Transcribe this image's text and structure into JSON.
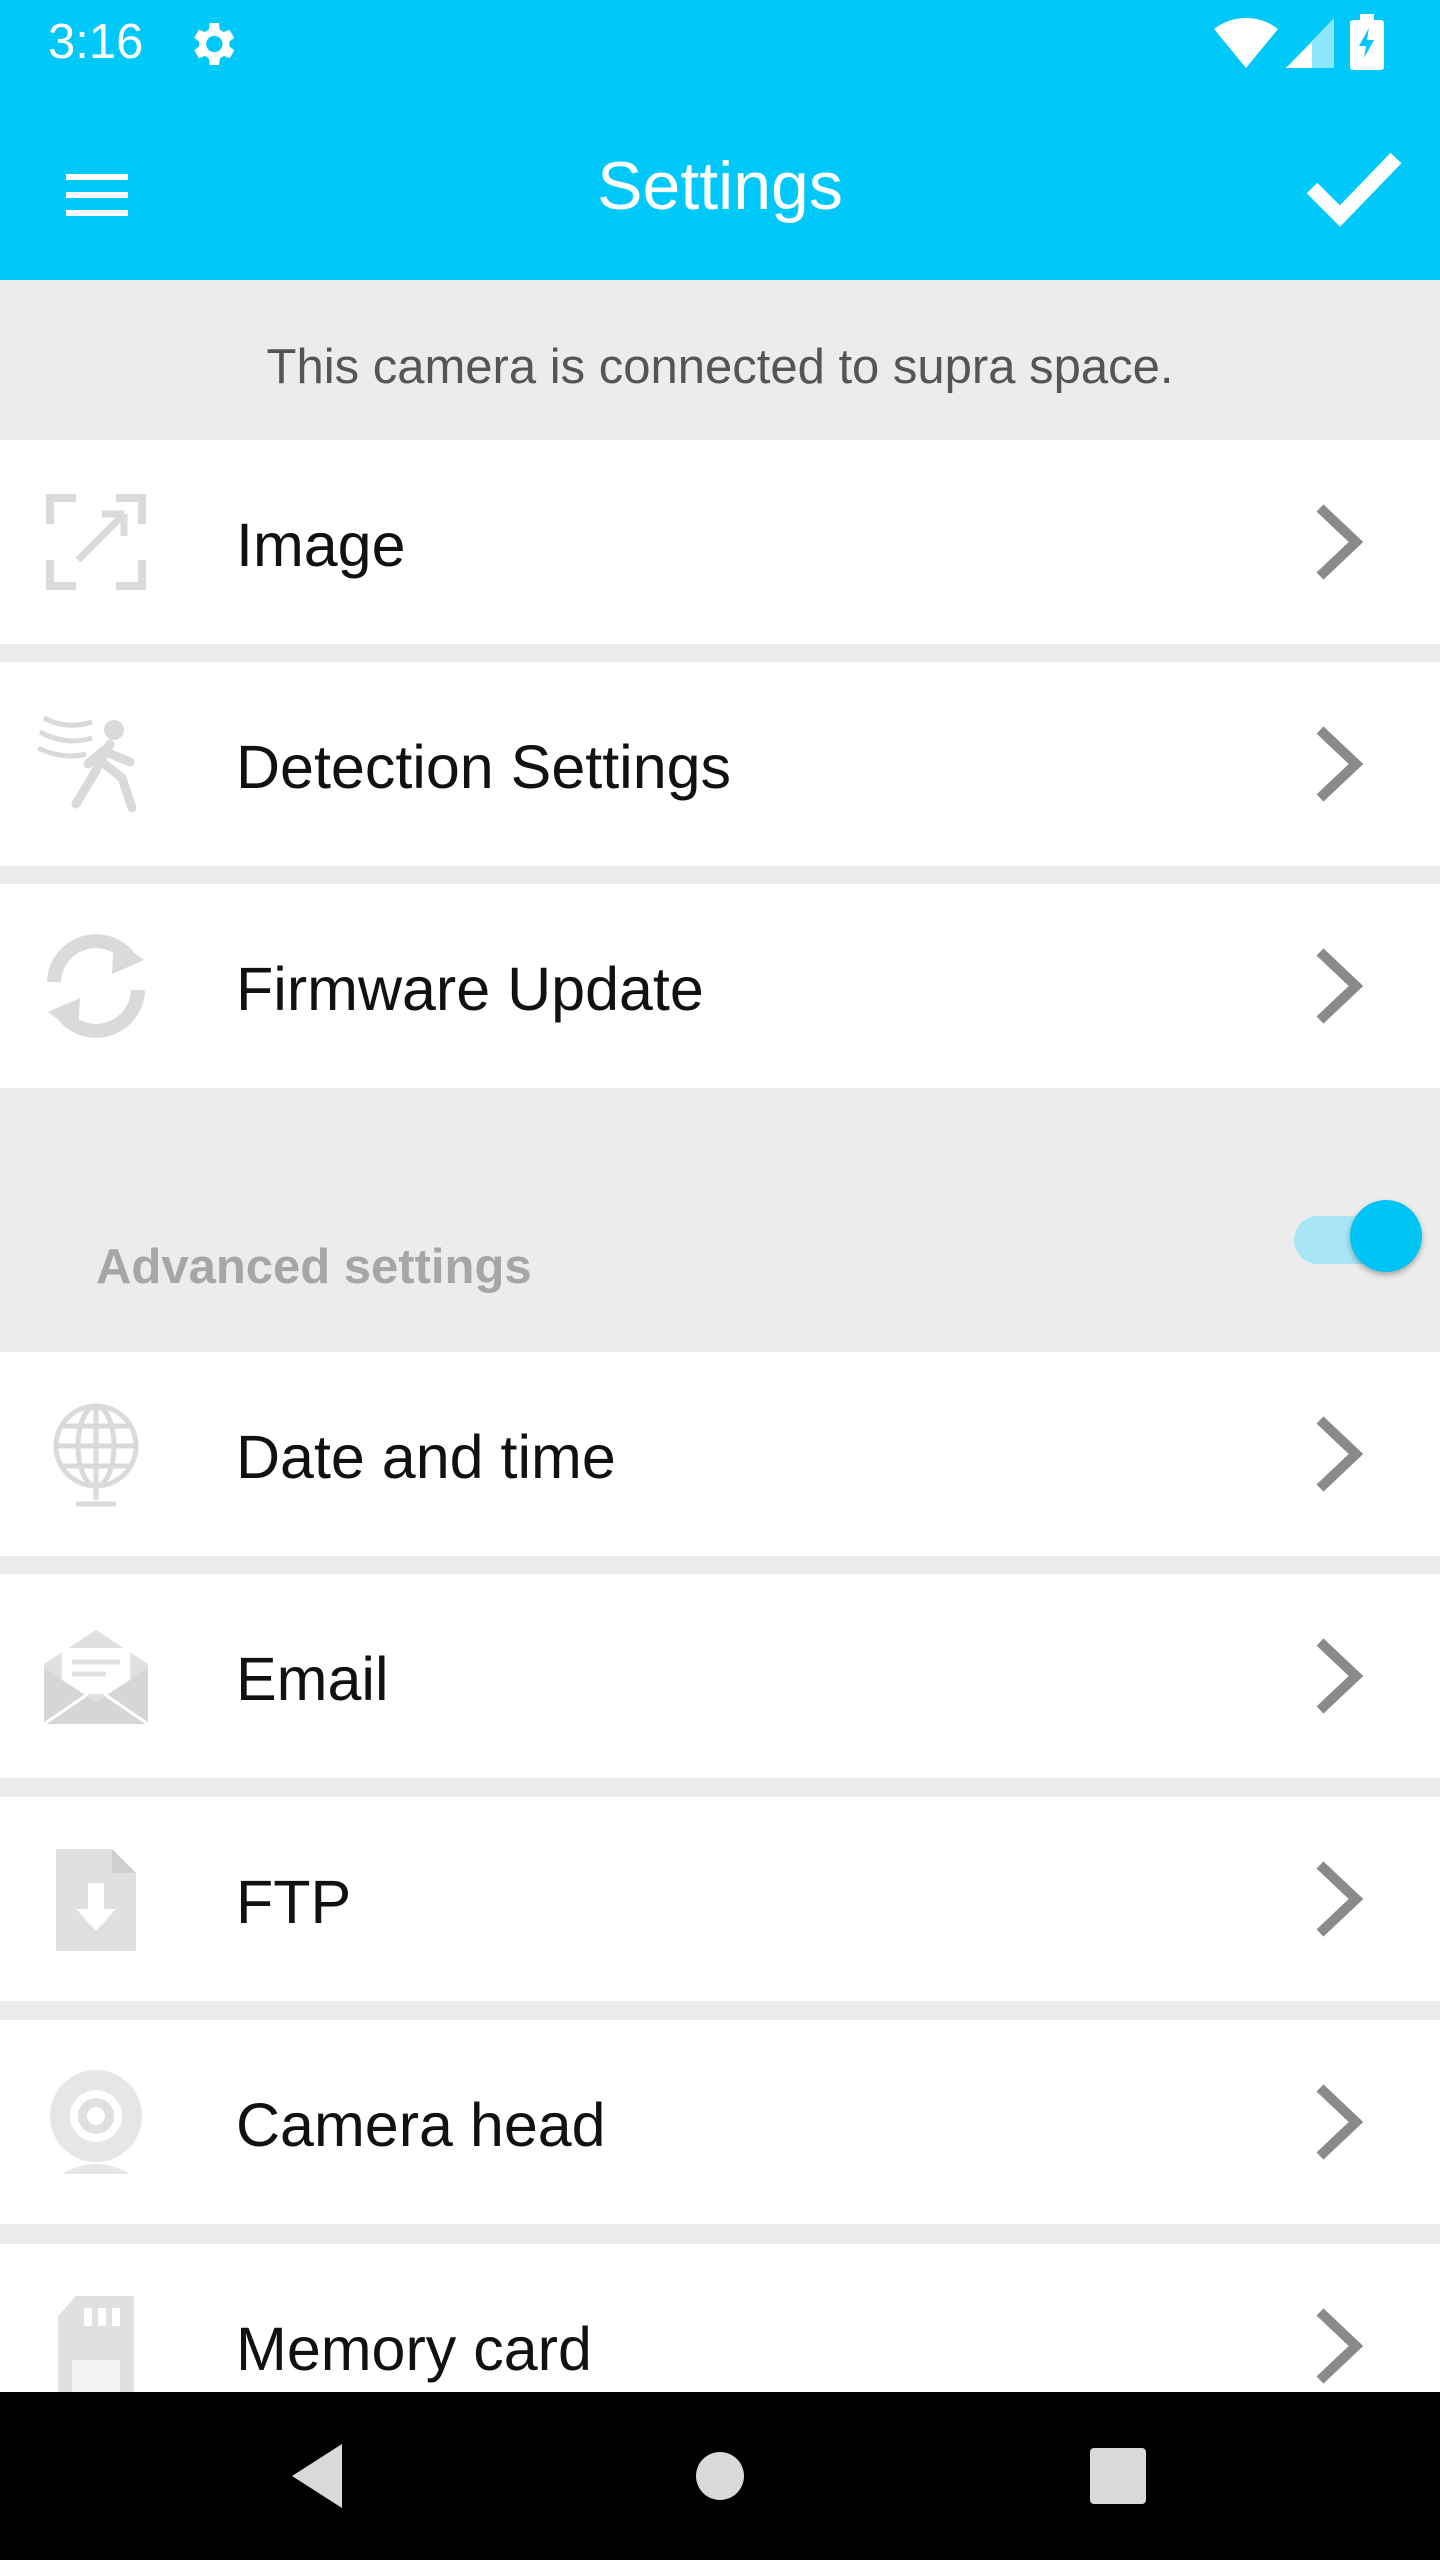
{
  "status_bar": {
    "time": "3:16",
    "icons": [
      "gear-icon",
      "wifi-icon",
      "cell-signal-icon",
      "battery-charging-icon"
    ]
  },
  "app_bar": {
    "title": "Settings",
    "menu_icon": "hamburger-menu-icon",
    "confirm_icon": "checkmark-icon"
  },
  "info_banner": {
    "text": "This camera is connected to supra space."
  },
  "settings_items": [
    {
      "label": "Image",
      "icon": "image-crop-icon"
    },
    {
      "label": "Detection Settings",
      "icon": "motion-detection-icon"
    },
    {
      "label": "Firmware Update",
      "icon": "update-sync-icon"
    }
  ],
  "advanced_settings": {
    "label": "Advanced settings",
    "toggle_on": true
  },
  "advanced_items": [
    {
      "label": "Date and time",
      "icon": "globe-icon"
    },
    {
      "label": "Email",
      "icon": "email-icon"
    },
    {
      "label": "FTP",
      "icon": "file-download-icon"
    },
    {
      "label": "Camera head",
      "icon": "webcam-icon"
    },
    {
      "label": "Memory card",
      "icon": "sd-card-icon"
    }
  ],
  "nav_bar": {
    "buttons": [
      "back-icon",
      "home-icon",
      "recents-icon"
    ]
  },
  "colors": {
    "primary": "#00c8f8",
    "background": "#ececec",
    "row_background": "#ffffff",
    "icon_gray": "#dcdcdc",
    "chevron_gray": "#8a8a8a"
  }
}
